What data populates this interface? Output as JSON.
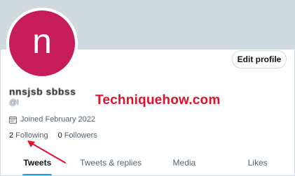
{
  "profile": {
    "avatar_letter": "n",
    "avatar_color": "#c71c5a",
    "edit_profile_label": "Edit profile",
    "display_name": "nnsjsb sbbss",
    "handle": "@l",
    "joined": "Joined February 2022",
    "joined_icon": "calendar-icon",
    "following_count": "2",
    "following_label": "Following",
    "followers_count": "0",
    "followers_label": "Followers"
  },
  "watermark": "Techniquehow.com",
  "annotation": {
    "type": "arrow",
    "color": "#e0102a",
    "points_to": "following"
  },
  "tabs": [
    {
      "label": "Tweets",
      "active": true
    },
    {
      "label": "Tweets & replies",
      "active": false
    },
    {
      "label": "Media",
      "active": false
    },
    {
      "label": "Likes",
      "active": false
    }
  ],
  "colors": {
    "accent": "#1d9bf0",
    "banner": "#cfd9de"
  }
}
